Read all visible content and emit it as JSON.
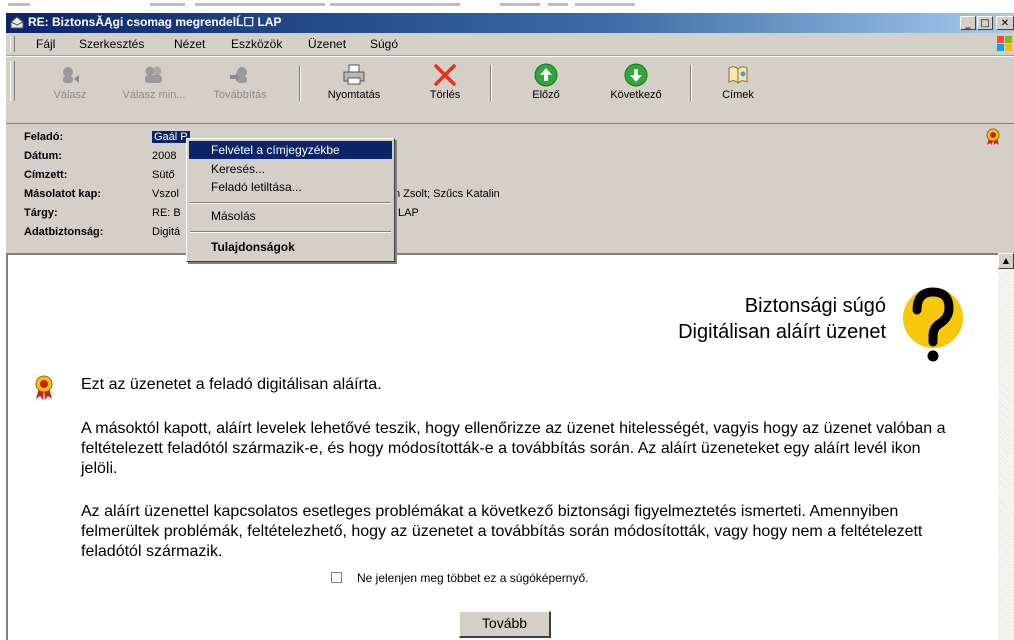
{
  "window": {
    "title": "RE: BiztonsĂĄgi csomag megrendelĹ☐ LAP",
    "min": "_",
    "max": "□",
    "close": "✕"
  },
  "menu": [
    "Fájl",
    "Szerkesztés",
    "Nézet",
    "Eszközök",
    "Üzenet",
    "Súgó"
  ],
  "toolbar": {
    "reply": "Válasz",
    "reply_all": "Válasz min...",
    "forward": "Továbbítás",
    "print": "Nyomtatás",
    "delete": "Törlés",
    "previous": "Előző",
    "next": "Következő",
    "addresses": "Címek"
  },
  "header": {
    "from_label": "Feladó:",
    "from_value": "Gaál P",
    "date_label": "Dátum:",
    "date_value": "2008",
    "to_label": "Címzett:",
    "to_value": "Sütő",
    "cc_label": "Másolatot kap:",
    "cc_value_start": "Vszol",
    "cc_value_end": "n Zsolt; Szűcs Katalin",
    "subject_label": "Tárgy:",
    "subject_value_start": "RE: B",
    "subject_value_end": "LAP",
    "security_label": "Adatbiztonság:",
    "security_value": "Digitá"
  },
  "context_menu": {
    "add_contact": "Felvétel a címjegyzékbe",
    "search": "Keresés...",
    "block_sender": "Feladó letiltása...",
    "copy": "Másolás",
    "properties": "Tulajdonságok"
  },
  "help": {
    "title_line1": "Biztonsági súgó",
    "title_line2": "Digitálisan aláírt üzenet",
    "para1": "Ezt az üzenetet a feladó digitálisan aláírta.",
    "para2": "A másoktól kapott, aláírt levelek lehetővé teszik, hogy ellenőrizze az üzenet hitelességét, vagyis hogy az üzenet valóban a feltételezett feladótól származik-e, és hogy módosították-e a továbbítás során. Az aláírt üzeneteket egy aláírt levél ikon jelöli.",
    "para3": "Az aláírt üzenettel kapcsolatos esetleges problémákat a következő biztonsági figyelmeztetés ismerteti. Amennyiben felmerültek problémák, feltételezhető, hogy az üzenetet a továbbítás során módosították, vagy hogy nem a feltételezett feladótól származik.",
    "checkbox_label": "Ne jelenjen meg többet ez a súgóképernyő.",
    "checkbox_checked": false,
    "next_button": "Tovább"
  }
}
